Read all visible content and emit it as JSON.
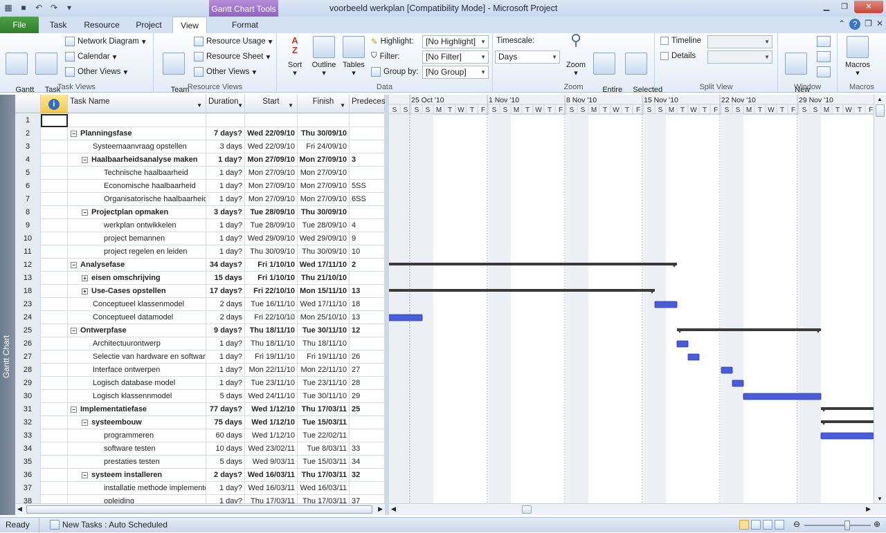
{
  "window": {
    "title": "voorbeeld werkplan [Compatibility Mode]  -  Microsoft Project",
    "contextual_tab_group": "Gantt Chart Tools"
  },
  "tabs": [
    "File",
    "Task",
    "Resource",
    "Project",
    "View",
    "Format"
  ],
  "active_tab": "View",
  "ribbon": {
    "task_views": {
      "label": "Task Views",
      "gantt_chart": "Gantt\nChart",
      "task_usage": "Task\nUsage",
      "network_diagram": "Network Diagram",
      "calendar": "Calendar",
      "other_views": "Other Views"
    },
    "resource_views": {
      "label": "Resource Views",
      "team_planner": "Team\nPlanner",
      "resource_usage": "Resource Usage",
      "resource_sheet": "Resource Sheet",
      "other_views": "Other Views"
    },
    "data": {
      "label": "Data",
      "sort": "Sort",
      "outline": "Outline",
      "tables": "Tables",
      "highlight_label": "Highlight:",
      "highlight_value": "[No Highlight]",
      "filter_label": "Filter:",
      "filter_value": "[No Filter]",
      "group_label": "Group by:",
      "group_value": "[No Group]"
    },
    "zoom": {
      "label": "Zoom",
      "timescale_label": "Timescale:",
      "timescale_value": "Days",
      "zoom": "Zoom",
      "entire_project": "Entire\nProject",
      "selected_tasks": "Selected\nTasks"
    },
    "split_view": {
      "label": "Split View",
      "timeline": "Timeline",
      "details": "Details"
    },
    "window": {
      "label": "Window",
      "new_window": "New\nWindow"
    },
    "macros": {
      "label": "Macros",
      "macros": "Macros"
    }
  },
  "view_bar_label": "Gantt Chart",
  "columns": {
    "name": "Task Name",
    "duration": "Duration",
    "start": "Start",
    "finish": "Finish",
    "predecessors": "Predeces"
  },
  "rows": [
    {
      "id": "1",
      "name": "",
      "dur": "",
      "start": "",
      "finish": "",
      "pred": "",
      "level": 0,
      "summary": false,
      "toggle": ""
    },
    {
      "id": "2",
      "name": "Planningsfase",
      "dur": "7 days?",
      "start": "Wed 22/09/10",
      "finish": "Thu 30/09/10",
      "pred": "",
      "level": 0,
      "summary": true,
      "toggle": "−"
    },
    {
      "id": "3",
      "name": "Systeemaanvraag opstellen",
      "dur": "3 days",
      "start": "Wed 22/09/10",
      "finish": "Fri 24/09/10",
      "pred": "",
      "level": 1,
      "summary": false,
      "toggle": ""
    },
    {
      "id": "4",
      "name": "Haalbaarheidsanalyse maken",
      "dur": "1 day?",
      "start": "Mon 27/09/10",
      "finish": "Mon 27/09/10",
      "pred": "3",
      "level": 1,
      "summary": true,
      "toggle": "−"
    },
    {
      "id": "5",
      "name": "Technische haalbaarheid",
      "dur": "1 day?",
      "start": "Mon 27/09/10",
      "finish": "Mon 27/09/10",
      "pred": "",
      "level": 2,
      "summary": false,
      "toggle": ""
    },
    {
      "id": "6",
      "name": "Economische haalbaarheid",
      "dur": "1 day?",
      "start": "Mon 27/09/10",
      "finish": "Mon 27/09/10",
      "pred": "5SS",
      "level": 2,
      "summary": false,
      "toggle": ""
    },
    {
      "id": "7",
      "name": "Organisatorische haalbaarheid",
      "dur": "1 day?",
      "start": "Mon 27/09/10",
      "finish": "Mon 27/09/10",
      "pred": "6SS",
      "level": 2,
      "summary": false,
      "toggle": ""
    },
    {
      "id": "8",
      "name": "Projectplan opmaken",
      "dur": "3 days?",
      "start": "Tue 28/09/10",
      "finish": "Thu 30/09/10",
      "pred": "",
      "level": 1,
      "summary": true,
      "toggle": "−"
    },
    {
      "id": "9",
      "name": "werkplan ontwikkelen",
      "dur": "1 day?",
      "start": "Tue 28/09/10",
      "finish": "Tue 28/09/10",
      "pred": "4",
      "level": 2,
      "summary": false,
      "toggle": ""
    },
    {
      "id": "10",
      "name": "project bemannen",
      "dur": "1 day?",
      "start": "Wed 29/09/10",
      "finish": "Wed 29/09/10",
      "pred": "9",
      "level": 2,
      "summary": false,
      "toggle": ""
    },
    {
      "id": "11",
      "name": "project regelen en leiden",
      "dur": "1 day?",
      "start": "Thu 30/09/10",
      "finish": "Thu 30/09/10",
      "pred": "10",
      "level": 2,
      "summary": false,
      "toggle": ""
    },
    {
      "id": "12",
      "name": "Analysefase",
      "dur": "34 days?",
      "start": "Fri 1/10/10",
      "finish": "Wed 17/11/10",
      "pred": "2",
      "level": 0,
      "summary": true,
      "toggle": "−"
    },
    {
      "id": "13",
      "name": "eisen omschrijving",
      "dur": "15 days",
      "start": "Fri 1/10/10",
      "finish": "Thu 21/10/10",
      "pred": "",
      "level": 1,
      "summary": true,
      "toggle": "+"
    },
    {
      "id": "18",
      "name": "Use-Cases opstellen",
      "dur": "17 days?",
      "start": "Fri 22/10/10",
      "finish": "Mon 15/11/10",
      "pred": "13",
      "level": 1,
      "summary": true,
      "toggle": "+"
    },
    {
      "id": "23",
      "name": "Conceptueel klassenmodel",
      "dur": "2 days",
      "start": "Tue 16/11/10",
      "finish": "Wed 17/11/10",
      "pred": "18",
      "level": 1,
      "summary": false,
      "toggle": ""
    },
    {
      "id": "24",
      "name": "Conceptueel datamodel",
      "dur": "2 days",
      "start": "Fri 22/10/10",
      "finish": "Mon 25/10/10",
      "pred": "13",
      "level": 1,
      "summary": false,
      "toggle": ""
    },
    {
      "id": "25",
      "name": "Ontwerpfase",
      "dur": "9 days?",
      "start": "Thu 18/11/10",
      "finish": "Tue 30/11/10",
      "pred": "12",
      "level": 0,
      "summary": true,
      "toggle": "−"
    },
    {
      "id": "26",
      "name": "Architectuurontwerp",
      "dur": "1 day?",
      "start": "Thu 18/11/10",
      "finish": "Thu 18/11/10",
      "pred": "",
      "level": 1,
      "summary": false,
      "toggle": ""
    },
    {
      "id": "27",
      "name": "Selectie van hardware en softwar",
      "dur": "1 day?",
      "start": "Fri 19/11/10",
      "finish": "Fri 19/11/10",
      "pred": "26",
      "level": 1,
      "summary": false,
      "toggle": ""
    },
    {
      "id": "28",
      "name": "Interface ontwerpen",
      "dur": "1 day?",
      "start": "Mon 22/11/10",
      "finish": "Mon 22/11/10",
      "pred": "27",
      "level": 1,
      "summary": false,
      "toggle": ""
    },
    {
      "id": "29",
      "name": "Logisch database model",
      "dur": "1 day?",
      "start": "Tue 23/11/10",
      "finish": "Tue 23/11/10",
      "pred": "28",
      "level": 1,
      "summary": false,
      "toggle": ""
    },
    {
      "id": "30",
      "name": "Logisch klassennmodel",
      "dur": "5 days",
      "start": "Wed 24/11/10",
      "finish": "Tue 30/11/10",
      "pred": "29",
      "level": 1,
      "summary": false,
      "toggle": ""
    },
    {
      "id": "31",
      "name": "Implementatiefase",
      "dur": "77 days?",
      "start": "Wed 1/12/10",
      "finish": "Thu 17/03/11",
      "pred": "25",
      "level": 0,
      "summary": true,
      "toggle": "−"
    },
    {
      "id": "32",
      "name": "systeembouw",
      "dur": "75 days",
      "start": "Wed 1/12/10",
      "finish": "Tue 15/03/11",
      "pred": "",
      "level": 1,
      "summary": true,
      "toggle": "−"
    },
    {
      "id": "33",
      "name": "programmeren",
      "dur": "60 days",
      "start": "Wed 1/12/10",
      "finish": "Tue 22/02/11",
      "pred": "",
      "level": 2,
      "summary": false,
      "toggle": ""
    },
    {
      "id": "34",
      "name": "software testen",
      "dur": "10 days",
      "start": "Wed 23/02/11",
      "finish": "Tue 8/03/11",
      "pred": "33",
      "level": 2,
      "summary": false,
      "toggle": ""
    },
    {
      "id": "35",
      "name": "prestaties testen",
      "dur": "5 days",
      "start": "Wed 9/03/11",
      "finish": "Tue 15/03/11",
      "pred": "34",
      "level": 2,
      "summary": false,
      "toggle": ""
    },
    {
      "id": "36",
      "name": "systeem installeren",
      "dur": "2 days?",
      "start": "Wed 16/03/11",
      "finish": "Thu 17/03/11",
      "pred": "32",
      "level": 1,
      "summary": true,
      "toggle": "−"
    },
    {
      "id": "37",
      "name": "installatie methode implementer",
      "dur": "1 day?",
      "start": "Wed 16/03/11",
      "finish": "Wed 16/03/11",
      "pred": "",
      "level": 2,
      "summary": false,
      "toggle": ""
    },
    {
      "id": "38",
      "name": "opleiding",
      "dur": "1 day?",
      "start": "Thu 17/03/11",
      "finish": "Thu 17/03/11",
      "pred": "37",
      "level": 2,
      "summary": false,
      "toggle": ""
    }
  ],
  "timescale": {
    "weeks": [
      "25 Oct '10",
      "1 Nov '10",
      "8 Nov '10",
      "15 Nov '10",
      "22 Nov '10",
      "29 Nov '10"
    ],
    "days": [
      "S",
      "S",
      "M",
      "T",
      "W",
      "T",
      "F"
    ],
    "first_partial_days": [
      "S",
      "S"
    ]
  },
  "status": {
    "ready": "Ready",
    "new_tasks": "New Tasks : Auto Scheduled"
  },
  "colors": {
    "bar": "#4a5cd8",
    "summary": "#3a3a3a",
    "file_tab": "#2d7c2a",
    "contextual": "#9a6fcc"
  }
}
